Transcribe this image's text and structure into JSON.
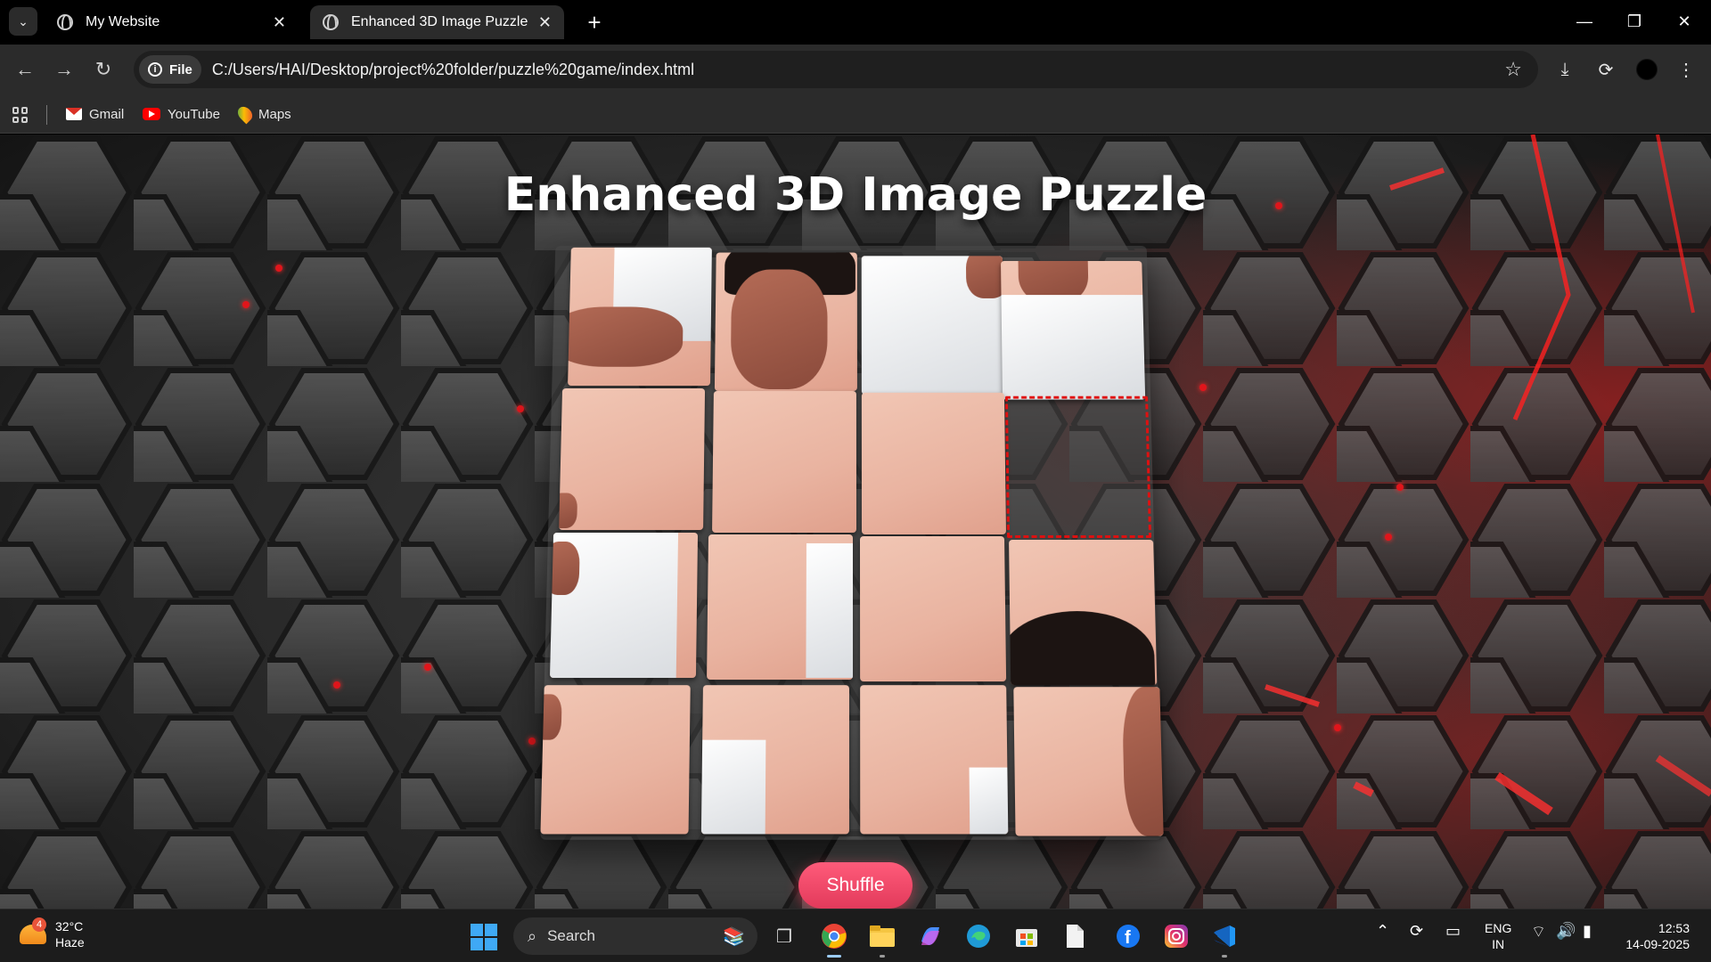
{
  "tabs": [
    {
      "title": "My Website"
    },
    {
      "title": "Enhanced 3D Image Puzzle"
    }
  ],
  "address": {
    "scheme_label": "File",
    "url": "C:/Users/HAI/Desktop/project%20folder/puzzle%20game/index.html"
  },
  "bookmarks": [
    {
      "label": "Gmail"
    },
    {
      "label": "YouTube"
    },
    {
      "label": "Maps"
    }
  ],
  "page": {
    "title": "Enhanced 3D Image Puzzle",
    "shuffle_label": "Shuffle",
    "grid": {
      "rows": 4,
      "cols": 4,
      "empty_cell": {
        "row": 2,
        "col": 4
      }
    }
  },
  "colors": {
    "accent_red": "#e01010",
    "button": "#ec4566",
    "background": "#2a2a2a"
  },
  "taskbar": {
    "weather_temp": "32°C",
    "weather_desc": "Haze",
    "weather_badge": "4",
    "search_placeholder": "Search",
    "lang_top": "ENG",
    "lang_bottom": "IN",
    "time": "12:53",
    "date": "14-09-2025"
  }
}
